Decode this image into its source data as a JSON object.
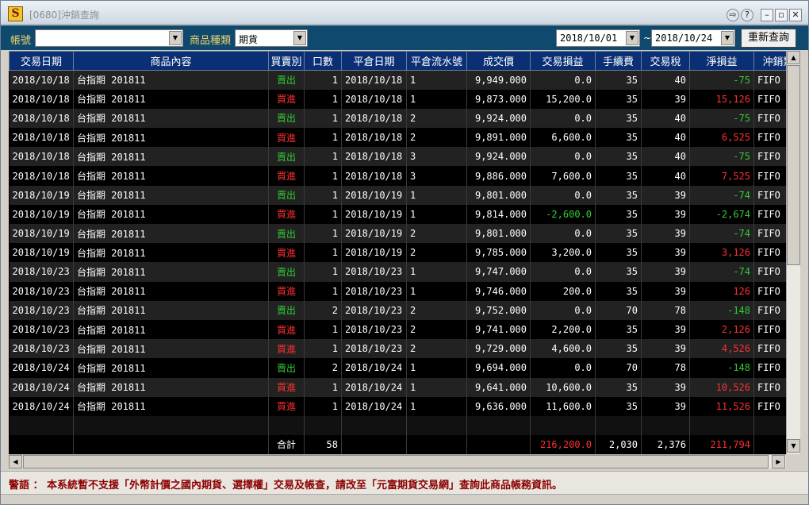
{
  "window": {
    "title": "[0680]沖銷查詢",
    "app_icon_glyph": "S"
  },
  "toolbar": {
    "account_label": "帳號",
    "account_value": "",
    "product_type_label": "商品種類",
    "product_type_value": "期貨",
    "date_from": "2018/10/01",
    "date_to": "2018/10/24",
    "date_separator": "~",
    "requery_label": "重新查詢"
  },
  "table": {
    "columns": [
      "交易日期",
      "商品內容",
      "買賣別",
      "口數",
      "平倉日期",
      "平倉流水號",
      "成交價",
      "交易損益",
      "手續費",
      "交易稅",
      "淨損益",
      "沖銷類"
    ],
    "rows": [
      [
        "2018/10/18",
        "台指期  201811",
        "賣出",
        "1",
        "2018/10/18",
        "1",
        "9,949.000",
        "0.0",
        "35",
        "40",
        "-75",
        "FIFO"
      ],
      [
        "2018/10/18",
        "台指期  201811",
        "買進",
        "1",
        "2018/10/18",
        "1",
        "9,873.000",
        "15,200.0",
        "35",
        "39",
        "15,126",
        "FIFO"
      ],
      [
        "2018/10/18",
        "台指期  201811",
        "賣出",
        "1",
        "2018/10/18",
        "2",
        "9,924.000",
        "0.0",
        "35",
        "40",
        "-75",
        "FIFO"
      ],
      [
        "2018/10/18",
        "台指期  201811",
        "買進",
        "1",
        "2018/10/18",
        "2",
        "9,891.000",
        "6,600.0",
        "35",
        "40",
        "6,525",
        "FIFO"
      ],
      [
        "2018/10/18",
        "台指期  201811",
        "賣出",
        "1",
        "2018/10/18",
        "3",
        "9,924.000",
        "0.0",
        "35",
        "40",
        "-75",
        "FIFO"
      ],
      [
        "2018/10/18",
        "台指期  201811",
        "買進",
        "1",
        "2018/10/18",
        "3",
        "9,886.000",
        "7,600.0",
        "35",
        "40",
        "7,525",
        "FIFO"
      ],
      [
        "2018/10/19",
        "台指期  201811",
        "賣出",
        "1",
        "2018/10/19",
        "1",
        "9,801.000",
        "0.0",
        "35",
        "39",
        "-74",
        "FIFO"
      ],
      [
        "2018/10/19",
        "台指期  201811",
        "買進",
        "1",
        "2018/10/19",
        "1",
        "9,814.000",
        "-2,600.0",
        "35",
        "39",
        "-2,674",
        "FIFO"
      ],
      [
        "2018/10/19",
        "台指期  201811",
        "賣出",
        "1",
        "2018/10/19",
        "2",
        "9,801.000",
        "0.0",
        "35",
        "39",
        "-74",
        "FIFO"
      ],
      [
        "2018/10/19",
        "台指期  201811",
        "買進",
        "1",
        "2018/10/19",
        "2",
        "9,785.000",
        "3,200.0",
        "35",
        "39",
        "3,126",
        "FIFO"
      ],
      [
        "2018/10/23",
        "台指期  201811",
        "賣出",
        "1",
        "2018/10/23",
        "1",
        "9,747.000",
        "0.0",
        "35",
        "39",
        "-74",
        "FIFO"
      ],
      [
        "2018/10/23",
        "台指期  201811",
        "買進",
        "1",
        "2018/10/23",
        "1",
        "9,746.000",
        "200.0",
        "35",
        "39",
        "126",
        "FIFO"
      ],
      [
        "2018/10/23",
        "台指期  201811",
        "賣出",
        "2",
        "2018/10/23",
        "2",
        "9,752.000",
        "0.0",
        "70",
        "78",
        "-148",
        "FIFO"
      ],
      [
        "2018/10/23",
        "台指期  201811",
        "買進",
        "1",
        "2018/10/23",
        "2",
        "9,741.000",
        "2,200.0",
        "35",
        "39",
        "2,126",
        "FIFO"
      ],
      [
        "2018/10/23",
        "台指期  201811",
        "買進",
        "1",
        "2018/10/23",
        "2",
        "9,729.000",
        "4,600.0",
        "35",
        "39",
        "4,526",
        "FIFO"
      ],
      [
        "2018/10/24",
        "台指期  201811",
        "賣出",
        "2",
        "2018/10/24",
        "1",
        "9,694.000",
        "0.0",
        "70",
        "78",
        "-148",
        "FIFO"
      ],
      [
        "2018/10/24",
        "台指期  201811",
        "買進",
        "1",
        "2018/10/24",
        "1",
        "9,641.000",
        "10,600.0",
        "35",
        "39",
        "10,526",
        "FIFO"
      ],
      [
        "2018/10/24",
        "台指期  201811",
        "買進",
        "1",
        "2018/10/24",
        "1",
        "9,636.000",
        "11,600.0",
        "35",
        "39",
        "11,526",
        "FIFO"
      ]
    ],
    "total": {
      "label": "合計",
      "lots": "58",
      "trade_pnl": "216,200.0",
      "fee": "2,030",
      "tax": "2,376",
      "net_pnl": "211,794"
    }
  },
  "notice": "警語 ： 本系統暫不支援「外幣計價之國內期貨、選擇權」交易及帳查，請改至「元富期貨交易網」查詢此商品帳務資訊。",
  "colors": {
    "header_bg": "#0a2f74",
    "toolbar_bg": "#0f4a6e",
    "buy": "#ff3030",
    "sell": "#33cc33",
    "label": "#f0d070"
  }
}
